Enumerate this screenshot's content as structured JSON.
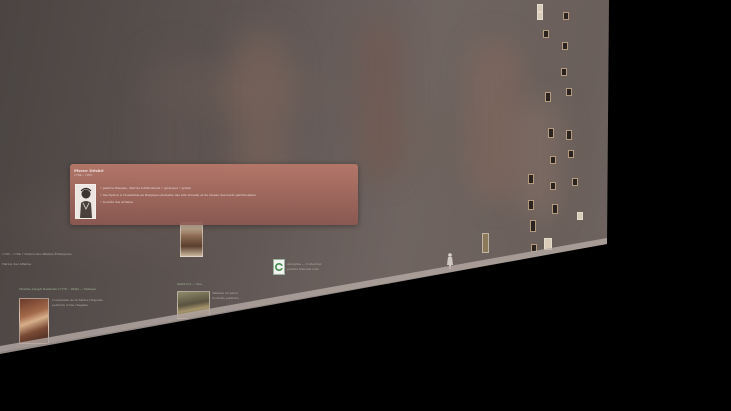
{
  "tooltip": {
    "title": "Pierre Désiré",
    "subtitle": "1794 – 1857",
    "lines": [
      "• peintre français, chef de fortifications • géologue • grand",
      "• inscription à l'Académie de Belgique (domaine des arts visuels) et du réseau des fonds patrimoniaux",
      "• Société des Artistes"
    ]
  },
  "wall": {
    "left_caption": "1792 – 1794 • Nation des Affaires Étrangères",
    "left_caption_2": "Nation des Affaires",
    "item1": {
      "header": "Charles Joseph Desmolin (1778 – 1840) — Tableau",
      "lines": [
        "Commande de la Sainte-Chapelle",
        "peinture d'une chapelle"
      ]
    },
    "item2": {
      "header": "Saint-Cyr — Vue",
      "lines": [
        "Tableau du salon",
        "nouvelle peinture"
      ]
    },
    "item3": {
      "lines": [
        "Anonyme — Collection",
        "peintre français vers"
      ]
    }
  },
  "colors": {
    "tooltip_top": "#b7786a",
    "tooltip_bottom": "#8c5850",
    "wall": "#6a5f5a",
    "background": "#000000"
  }
}
